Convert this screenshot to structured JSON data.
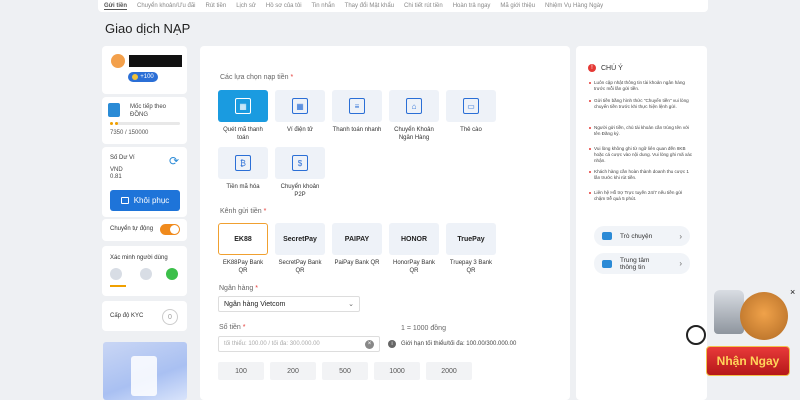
{
  "tabs": [
    "Gửi tiền",
    "Chuyển khoản/Ưu đãi",
    "Rút tiền",
    "Lịch sử",
    "Hồ sơ của tôi",
    "Tin nhắn",
    "Thay đổi Mật khẩu",
    "Chi tiết rút tiền",
    "Hoàn trả ngay",
    "Mã giới thiệu",
    "Nhiệm Vụ Hàng Ngày"
  ],
  "page_title": "Giao dịch NẠP",
  "profile": {
    "points": "+100"
  },
  "level": {
    "label": "Mốc tiếp theo ĐỒNG",
    "value": "7350 / 150000",
    "progress_percent": 5
  },
  "balance": {
    "title": "Số Dư Ví",
    "currency": "VND",
    "amount": "0.81",
    "restore_label": "Khôi phục"
  },
  "auto_transfer": {
    "label": "Chuyển tự động",
    "enabled": true
  },
  "verify": {
    "label": "Xác minh người dùng"
  },
  "kyc": {
    "label": "Cấp độ KYC",
    "level": "0"
  },
  "deposit_options": {
    "label": "Các lựa chọn nạp tiền",
    "items": [
      {
        "label": "Quét mã thanh toán",
        "icon": "qr-scan-icon",
        "selected": true
      },
      {
        "label": "Ví điện tử",
        "icon": "qr-wallet-icon",
        "selected": false
      },
      {
        "label": "Thanh toán nhanh",
        "icon": "fast-pay-icon",
        "selected": false
      },
      {
        "label": "Chuyển Khoản Ngân Hàng",
        "icon": "bank-icon",
        "selected": false
      },
      {
        "label": "Thẻ cào",
        "icon": "card-icon",
        "selected": false
      },
      {
        "label": "Tiền mã hóa",
        "icon": "crypto-icon",
        "selected": false
      },
      {
        "label": "Chuyển khoản P2P",
        "icon": "p2p-icon",
        "selected": false
      }
    ]
  },
  "channels": {
    "label": "Kênh gửi tiền",
    "items": [
      {
        "label": "EK88Pay Bank QR",
        "logo": "EK88",
        "selected": true
      },
      {
        "label": "SecretPay Bank QR",
        "logo": "SecretPay",
        "selected": false
      },
      {
        "label": "PaiPay Bank QR",
        "logo": "PAIPAY",
        "selected": false
      },
      {
        "label": "HonorPay Bank QR",
        "logo": "HONOR",
        "selected": false
      },
      {
        "label": "Truepay 3 Bank QR",
        "logo": "TruePay",
        "selected": false
      }
    ]
  },
  "bank": {
    "label": "Ngân hàng",
    "value": "Ngân hàng Vietcom"
  },
  "amount": {
    "label": "Số tiền",
    "placeholder": "tối thiểu: 100.00 / tối đa: 300.000.00",
    "unit": "1 = 1000 đồng",
    "limit": "Giới hạn tối thiểu/tối đa: 100.00/300.000.00"
  },
  "quick_amounts": [
    "100",
    "200",
    "500",
    "1000",
    "2000"
  ],
  "notes": {
    "title": "CHÚ Ý",
    "items": [
      "Luôn cập nhật thông tin tài khoản ngân hàng trước mỗi lần gửi tiền.",
      "Gửi tiền bằng hình thức \"Chuyển tiền\" vui lòng chuyển tiền trước khi thực hiện lệnh gửi.",
      "Người gửi tiền, chủ tài khoản cần trùng tên với tên Đăng ký.",
      "Vui lòng không ghi từ ngữ liên quan đến 8KB hoặc cá cược vào nội dung. Vui lòng ghi mã xác nhận.",
      "Khách hàng cần hoàn thành doanh thu cược 1 lần trước khi rút tiền.",
      "Liên hệ Hỗ trợ Trực tuyến 24/7 nếu tiền gửi chậm trễ quá 5 phút."
    ],
    "chat_label": "Trò chuyện",
    "info_center_label": "Trung tâm thông tin"
  },
  "promo_widget": {
    "label": "Nhận Ngay",
    "close": "×"
  }
}
